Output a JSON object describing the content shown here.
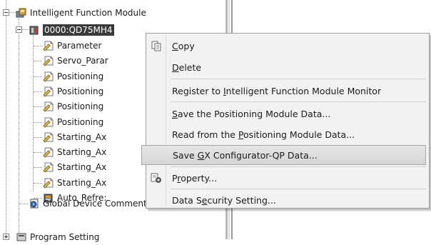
{
  "tree": {
    "module_group": "Intelligent Function Module",
    "module": "0000:QD75MH4",
    "children": [
      "Parameter",
      "Servo_Parar",
      "Positioning",
      "Positioning",
      "Positioning",
      "Positioning",
      "Starting_Ax",
      "Starting_Ax",
      "Starting_Ax",
      "Starting_Ax",
      "Auto_Refre:"
    ],
    "global_comment": "Global Device Comment",
    "program_setting": "Program Setting"
  },
  "context_menu": {
    "items": [
      {
        "label": "Copy",
        "access_key": "C",
        "icon": "copy-icon"
      },
      {
        "label": "Delete",
        "access_key": "D"
      },
      {
        "label": "Register to Intelligent Function Module Monitor",
        "access_key": "I"
      },
      {
        "label": "Save the Positioning Module Data...",
        "access_key": "S"
      },
      {
        "label": "Read from the Positioning Module Data...",
        "access_key": "P"
      },
      {
        "label": "Save GX Configurator-QP Data...",
        "access_key": "G",
        "highlighted": true
      },
      {
        "label": "Property...",
        "access_key": "r",
        "icon": "property-icon"
      },
      {
        "label": "Data Security Setting...",
        "access_key": "e"
      }
    ]
  }
}
